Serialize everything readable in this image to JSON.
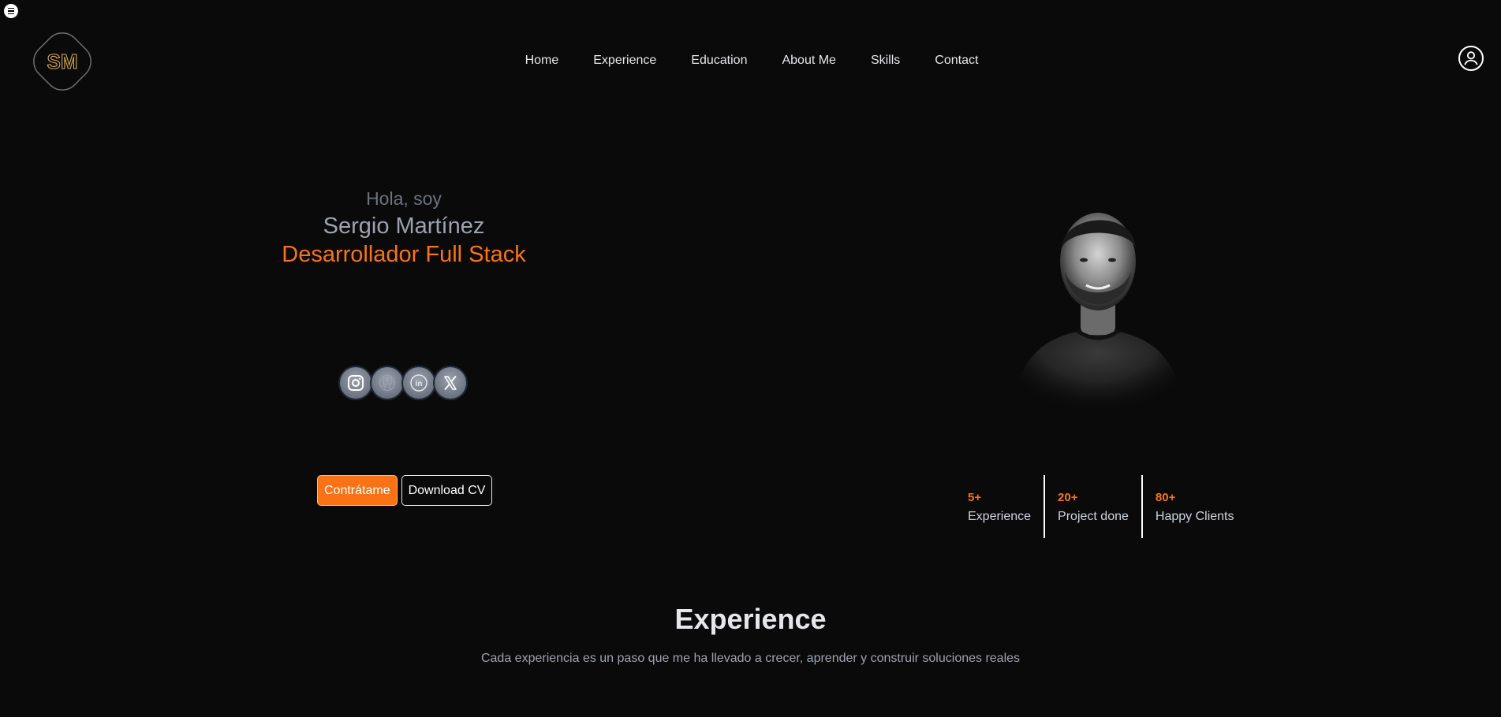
{
  "header": {
    "logo_text": "SM",
    "nav": [
      {
        "label": "Home"
      },
      {
        "label": "Experience"
      },
      {
        "label": "Education"
      },
      {
        "label": "About Me"
      },
      {
        "label": "Skills"
      },
      {
        "label": "Contact"
      }
    ],
    "icons": {
      "menu": "menu-icon",
      "user": "user-icon"
    }
  },
  "hero": {
    "greeting": "Hola, soy",
    "name": "Sergio Martínez",
    "role": "Desarrollador Full Stack",
    "socials": [
      {
        "icon": "instagram-icon"
      },
      {
        "icon": "github-icon"
      },
      {
        "icon": "linkedin-icon"
      },
      {
        "icon": "x-icon"
      }
    ],
    "primary_button": "Contrátame",
    "secondary_button": "Download CV"
  },
  "stats": [
    {
      "value": "5+",
      "label": "Experience"
    },
    {
      "value": "20+",
      "label": "Project done"
    },
    {
      "value": "80+",
      "label": "Happy Clients"
    }
  ],
  "experience": {
    "title": "Experience",
    "subtitle": "Cada experiencia es un paso que me ha llevado a crecer, aprender y construir soluciones reales"
  },
  "colors": {
    "background": "#0b0a0a",
    "accent": "#f97316",
    "muted_text": "#9ca3af"
  }
}
